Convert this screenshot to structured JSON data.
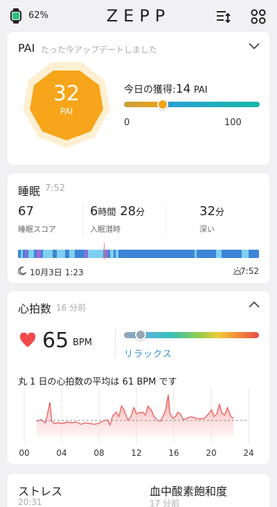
{
  "status": {
    "battery": "62%",
    "app_logo": "ZEPP"
  },
  "icons": {
    "watch": "watch-icon",
    "sort": "sort-icon",
    "grid": "grid-icon"
  },
  "pai": {
    "title": "PAI",
    "subtitle": "たった今アップデートしました",
    "value": "32",
    "unit": "PAI",
    "today_label": "今日の獲得:",
    "today_value": "14",
    "today_unit": "PAI",
    "min": "0",
    "max": "100",
    "progress_fraction": 0.28
  },
  "sleep": {
    "title": "睡眠",
    "duration": "7:52",
    "score": "67",
    "score_label": "睡眠スコア",
    "latency_hours": "6",
    "latency_hours_unit": "時間",
    "latency_minutes": "28",
    "latency_minutes_unit": "分",
    "latency_label": "入眠潜時",
    "deep": "32",
    "deep_unit": "分",
    "deep_label": "深い",
    "start": "10月3日 1:23",
    "end": "7:52"
  },
  "heart_rate": {
    "title": "心拍数",
    "updated": "16 分前",
    "value": "65",
    "unit": "BPM",
    "zone": "リラックス",
    "zone_fraction": 0.1,
    "avg_text": "丸 1 日の心拍数の平均は 61 BPM です",
    "chart_data": {
      "type": "area",
      "x_tick_labels": [
        "00",
        "04",
        "08",
        "12",
        "16",
        "20",
        "24"
      ],
      "xlim": [
        0,
        24
      ],
      "average": 61,
      "values": [
        [
          0,
          60
        ],
        [
          0.5,
          62
        ],
        [
          1,
          58
        ],
        [
          1.5,
          85
        ],
        [
          1.7,
          60
        ],
        [
          2,
          57
        ],
        [
          2.5,
          58
        ],
        [
          3,
          57
        ],
        [
          3.5,
          59
        ],
        [
          4,
          58
        ],
        [
          4.5,
          59
        ],
        [
          5,
          56
        ],
        [
          5.5,
          58
        ],
        [
          6,
          57
        ],
        [
          6.5,
          56
        ],
        [
          7,
          57
        ],
        [
          7.5,
          60
        ],
        [
          8,
          62
        ],
        [
          8.3,
          55
        ],
        [
          8.6,
          67
        ],
        [
          9,
          72
        ],
        [
          9.3,
          66
        ],
        [
          9.6,
          80
        ],
        [
          9.9,
          75
        ],
        [
          10.3,
          62
        ],
        [
          10.6,
          64
        ],
        [
          11,
          78
        ],
        [
          11.3,
          70
        ],
        [
          11.6,
          71
        ],
        [
          12,
          72
        ],
        [
          12.3,
          68
        ],
        [
          12.6,
          80
        ],
        [
          13,
          74
        ],
        [
          13.3,
          66
        ],
        [
          13.6,
          62
        ],
        [
          14,
          60
        ],
        [
          14.3,
          66
        ],
        [
          14.6,
          75
        ],
        [
          14.9,
          95
        ],
        [
          15.1,
          70
        ],
        [
          15.4,
          64
        ],
        [
          15.7,
          66
        ],
        [
          16,
          72
        ],
        [
          16.3,
          69
        ],
        [
          16.6,
          62
        ],
        [
          17,
          64
        ],
        [
          17.5,
          66
        ],
        [
          18,
          64
        ],
        [
          18.5,
          63
        ],
        [
          19,
          64
        ],
        [
          19.5,
          70
        ],
        [
          19.8,
          75
        ],
        [
          20.1,
          66
        ],
        [
          20.4,
          70
        ],
        [
          20.7,
          82
        ],
        [
          21,
          70
        ],
        [
          21.3,
          68
        ],
        [
          21.6,
          78
        ],
        [
          22,
          66
        ],
        [
          22.3,
          64
        ]
      ]
    }
  },
  "bottom": {
    "stress_title": "ストレス",
    "stress_time": "20:31",
    "spo2_title": "血中酸素飽和度",
    "spo2_time": "17 分前"
  }
}
